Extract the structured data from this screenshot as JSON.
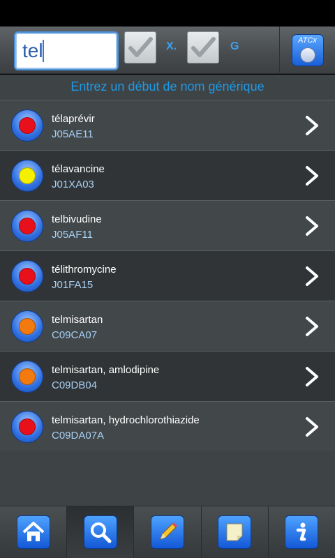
{
  "search": {
    "value": "tel",
    "check_x_label": "X.",
    "check_g_label": "G",
    "atc_button_label": "ATCx"
  },
  "hint": "Entrez un début de nom générique",
  "rows": [
    {
      "name": "télaprévir",
      "code": "J05AE11",
      "dot_color": "#e8101a"
    },
    {
      "name": "télavancine",
      "code": "J01XA03",
      "dot_color": "#f5f000"
    },
    {
      "name": "telbivudine",
      "code": "J05AF11",
      "dot_color": "#e8101a"
    },
    {
      "name": "télithromycine",
      "code": "J01FA15",
      "dot_color": "#e8101a"
    },
    {
      "name": "telmisartan",
      "code": "C09CA07",
      "dot_color": "#f27a0e"
    },
    {
      "name": "telmisartan, amlodipine",
      "code": "C09DB04",
      "dot_color": "#f27a0e"
    },
    {
      "name": "telmisartan, hydrochlorothiazide",
      "code": "C09DA07A",
      "dot_color": "#e8101a"
    }
  ],
  "tabs": [
    {
      "icon": "home-icon"
    },
    {
      "icon": "search-icon"
    },
    {
      "icon": "pencil-icon"
    },
    {
      "icon": "note-icon"
    },
    {
      "icon": "info-icon"
    }
  ]
}
